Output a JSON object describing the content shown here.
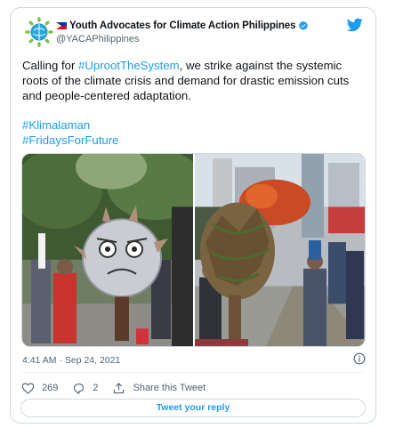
{
  "author": {
    "display_name": "Youth Advocates for Climate Action Philippines",
    "handle": "@YACAPhilippines",
    "verified": true
  },
  "tweet": {
    "text_before": "Calling for ",
    "text_link": "#UprootTheSystem",
    "text_after": ", we strike against the systemic roots of the climate crisis and demand for drastic emission cuts and people-centered adaptation.",
    "hashtags": [
      "#Klimalaman",
      "#FridaysForFuture"
    ]
  },
  "meta": {
    "timestamp": "4:41 AM · Sep 24, 2021"
  },
  "actions": {
    "like_count": "269",
    "reply_count": "2",
    "share_label": "Share this Tweet"
  },
  "reply_button": {
    "label": "Tweet your reply"
  },
  "colors": {
    "accent": "#1d9bf0",
    "text": "#0f1419",
    "muted": "#536471",
    "border": "#cfd9de"
  },
  "icons": [
    "yacap-logo",
    "philippines-flag-icon",
    "verified-badge-icon",
    "twitter-bird-icon",
    "info-icon",
    "heart-icon",
    "reply-icon",
    "share-icon"
  ]
}
